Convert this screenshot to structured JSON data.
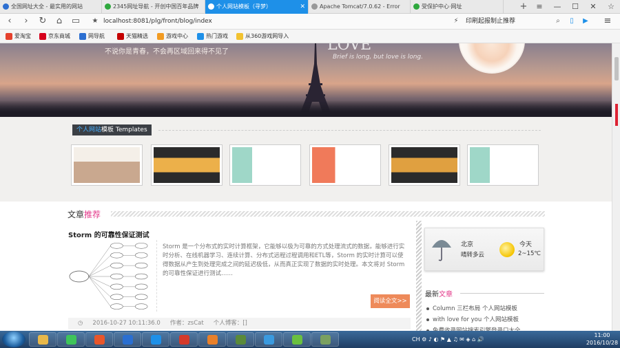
{
  "browser": {
    "tabs": [
      {
        "label": "全国网址大全 - 最实用的网站",
        "color": "#2c6fd1"
      },
      {
        "label": "2345网址导航 - 开创中国百年品牌",
        "color": "#2fa83e"
      },
      {
        "label": "个人网站模板（寻梦）",
        "color": "#ffffff",
        "active": true
      },
      {
        "label": "Apache Tomcat/7.0.62 - Error",
        "color": "#999999"
      },
      {
        "label": "受保护中心·网址",
        "color": "#2fa83e"
      }
    ],
    "new_tab": "+",
    "window_controls": [
      "≡",
      "—",
      "☐",
      "✕",
      "☆"
    ],
    "url": "localhost:8081/plg/front/blog/index",
    "search_text": "印刷起报制止推荐",
    "bookmarks": [
      {
        "label": "爱淘宝",
        "color": "#e5412d"
      },
      {
        "label": "京东商城",
        "color": "#d6001c"
      },
      {
        "label": "网导航",
        "color": "#2c6fd1"
      },
      {
        "label": "天猫精选",
        "color": "#c40000"
      },
      {
        "label": "游戏中心",
        "color": "#f29b22"
      },
      {
        "label": "热门游戏",
        "color": "#1e90e8"
      },
      {
        "label": "从360游戏网导入",
        "color": "#f2c230"
      }
    ]
  },
  "banner": {
    "slogan": "不说你是青春，不会再区域回来得不见了",
    "love": "LOVE",
    "love_line": "Brief is long, but love is long."
  },
  "templates": {
    "header_main": "个人网站",
    "header_accent": "模板",
    "header_sub": "Templates",
    "items": [
      {
        "top": "#f4efe8",
        "bottom": "#c9a88f"
      },
      {
        "top": "#2b2b2b",
        "bottom": "#ecb04a"
      },
      {
        "top": "#9fd7c8",
        "bottom": "#ffffff"
      },
      {
        "top": "#ffffff",
        "bottom": "#f07a5a"
      },
      {
        "top": "#2b2b2b",
        "bottom": "#e0a040"
      },
      {
        "top": "#9fd7c8",
        "bottom": "#ffffff"
      }
    ]
  },
  "article": {
    "section_main": "文章",
    "section_accent": "推荐",
    "title": "Storm 的可靠性保证测试",
    "body": "Storm 是一个分布式的实时计算框架，它能够以极为可靠的方式处理流式的数据，能够进行实时分析、在线机器学习、连续计算、分布式远程过程调用和ETL等，Storm 的实时计算可以使得数据从产生到处理完成之间的延迟极低，从而真正实现了数据的实时处理。本文将对 Storm 的可靠性保证进行测试……",
    "more_button": "阅读全文>>",
    "meta_date": "2016-10-27 10:11:36.0",
    "meta_author": "作者：zsCat",
    "meta_category": "个人博客：[]"
  },
  "weather": {
    "city": "北京",
    "condition": "晴转多云",
    "day": "今天",
    "temp": "2~15℃"
  },
  "latest": {
    "title_main": "最新",
    "title_accent": "文章",
    "items": [
      "Column 三栏布局 个人网站模板",
      "with love for you 个人网站模板",
      "免费收录网站搜索引擎登录口大全"
    ]
  },
  "taskbar": {
    "apps": [
      "#e8b84a",
      "#3ec45a",
      "#e8562b",
      "#2a6fd1",
      "#1e90e8",
      "#d43a2a",
      "#e8802a",
      "#5a8a3a",
      "#3a9adf",
      "#6ac040",
      "#7aa060"
    ],
    "tray_lang": "CH",
    "time": "11:00",
    "date": "2016/10/28"
  }
}
